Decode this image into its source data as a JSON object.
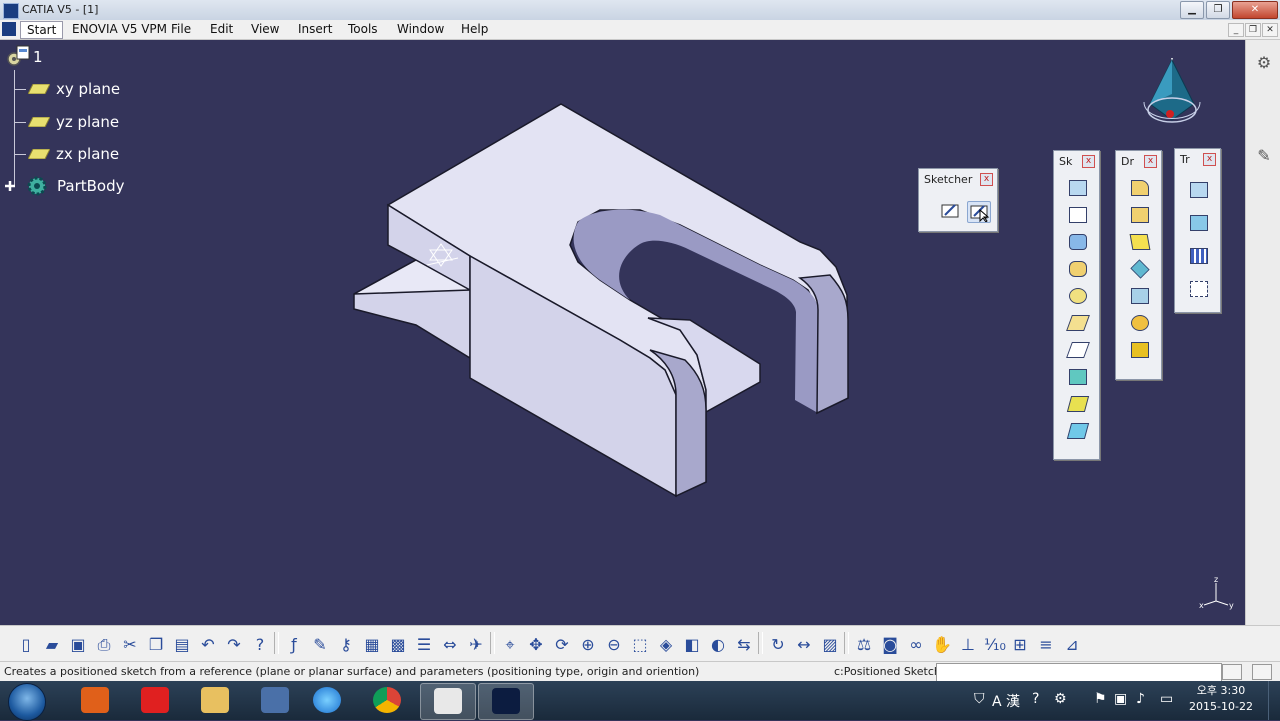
{
  "window": {
    "title": "CATIA V5 - [1]"
  },
  "menu": {
    "items": [
      "Start",
      "ENOVIA V5 VPM",
      "File",
      "Edit",
      "View",
      "Insert",
      "Tools",
      "Window",
      "Help"
    ]
  },
  "tree": {
    "root": "1",
    "nodes": [
      "xy plane",
      "yz plane",
      "zx plane",
      "PartBody"
    ]
  },
  "toolbars": {
    "sketcher": {
      "title": "Sketcher",
      "buttons": [
        "sketch-icon",
        "positioned-sketch-icon"
      ]
    },
    "sketch_based": {
      "title": "Sk",
      "buttons": [
        "pad-icon",
        "pocket-icon",
        "shaft-icon",
        "groove-icon",
        "hole-icon",
        "rib-icon",
        "slot-icon",
        "stiffener-icon",
        "multi-sections-solid-icon",
        "removed-multi-sections-icon"
      ]
    },
    "dress_up": {
      "title": "Dr",
      "buttons": [
        "edge-fillet-icon",
        "chamfer-icon",
        "draft-icon",
        "shell-icon",
        "thickness-icon",
        "thread-icon",
        "remove-face-icon"
      ]
    },
    "transformation": {
      "title": "Tr",
      "buttons": [
        "translation-icon",
        "mirror-icon",
        "rectangular-pattern-icon",
        "scaling-icon"
      ]
    }
  },
  "bottom_toolbar": {
    "icons": [
      "new-icon",
      "open-icon",
      "save-icon",
      "print-icon",
      "cut-icon",
      "copy-icon",
      "paste-icon",
      "undo-icon",
      "redo-icon",
      "whats-this-icon",
      "formula-icon",
      "comment-icon",
      "knowledge-icon",
      "table-icon",
      "design-table-icon",
      "catalog-icon",
      "measure-icon",
      "fly-mode-icon",
      "fit-all-icon",
      "pan-icon",
      "rotate-icon",
      "zoom-in-icon",
      "zoom-out-icon",
      "normal-view-icon",
      "iso-view-icon",
      "shading-icon",
      "hide-show-icon",
      "swap-visible-icon",
      "update-icon",
      "measure-between-icon",
      "measure-item-icon",
      "mass-icon",
      "capture-icon",
      "loop-icon",
      "grab-icon",
      "axis-system-icon",
      "scale-icon",
      "std-icon",
      "list-icon",
      "catia-logo"
    ]
  },
  "status": {
    "message": "Creates a positioned sketch from a reference (plane or planar surface) and parameters (positioning type, origin and oriention)",
    "command": "c:Positioned Sketch",
    "input_value": ""
  },
  "taskbar": {
    "apps": [
      "media-player-icon",
      "ilbe-app-icon",
      "file-explorer-icon",
      "korean-2015-icon",
      "internet-explorer-icon",
      "chrome-icon",
      "paint-icon",
      "catia-icon"
    ],
    "active_index": 7,
    "tray_lang": "A 漢",
    "time": "오후 3:30",
    "date": "2015-10-22"
  },
  "colors": {
    "viewport": "#34345a",
    "part_top": "#e3e3f3",
    "part_side": "#c8c8e2",
    "part_front": "#d3d3ea",
    "tree_text": "#ffffff"
  }
}
